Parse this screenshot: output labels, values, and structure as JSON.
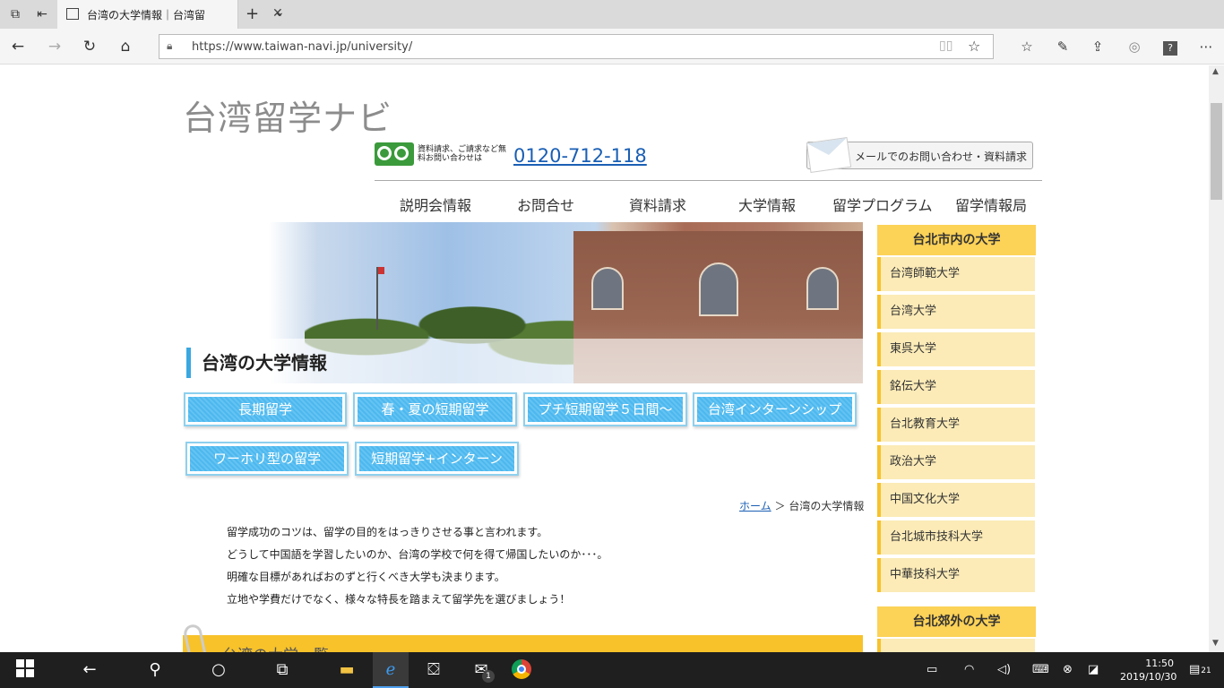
{
  "browser": {
    "tab_title": "台湾の大学情報｜台湾留",
    "url": "https://www.taiwan-navi.jp/university/"
  },
  "site": {
    "logo": "台湾留学ナビ",
    "freedial_note": "資料請求、ご請求など無料お問い合わせは",
    "phone": "0120-712-118",
    "mail_button": "メールでのお問い合わせ・資料請求",
    "nav": [
      "説明会情報",
      "お問合せ",
      "資料請求",
      "大学情報",
      "留学プログラム",
      "留学情報局"
    ]
  },
  "hero": {
    "title": "台湾の大学情報"
  },
  "categories": [
    "長期留学",
    "春・夏の短期留学",
    "プチ短期留学５日間～",
    "台湾インターンシップ",
    "ワーホリ型の留学",
    "短期留学+インターン"
  ],
  "breadcrumb": {
    "home": "ホーム",
    "sep": "＞",
    "current": "台湾の大学情報"
  },
  "intro": [
    "留学成功のコツは、留学の目的をはっきりさせる事と言われます。",
    "どうして中国語を学習したいのか、台湾の学校で何を得て帰国したいのか･･･。",
    "明確な目標があればおのずと行くべき大学も決まります。",
    "立地や学費だけでなく、様々な特長を踏まえて留学先を選びましょう！"
  ],
  "list_section_title": "台湾の大学一覧",
  "sidebar": {
    "taipei_head": "台北市内の大学",
    "taipei_items": [
      "台湾師範大学",
      "台湾大学",
      "東呉大学",
      "銘伝大学",
      "台北教育大学",
      "政治大学",
      "中国文化大学",
      "台北城市技科大学",
      "中華技科大学"
    ],
    "suburb_head": "台北郊外の大学"
  },
  "taskbar": {
    "mail_badge": "1",
    "time": "11:50",
    "date": "2019/10/30",
    "notif_count": "21"
  }
}
